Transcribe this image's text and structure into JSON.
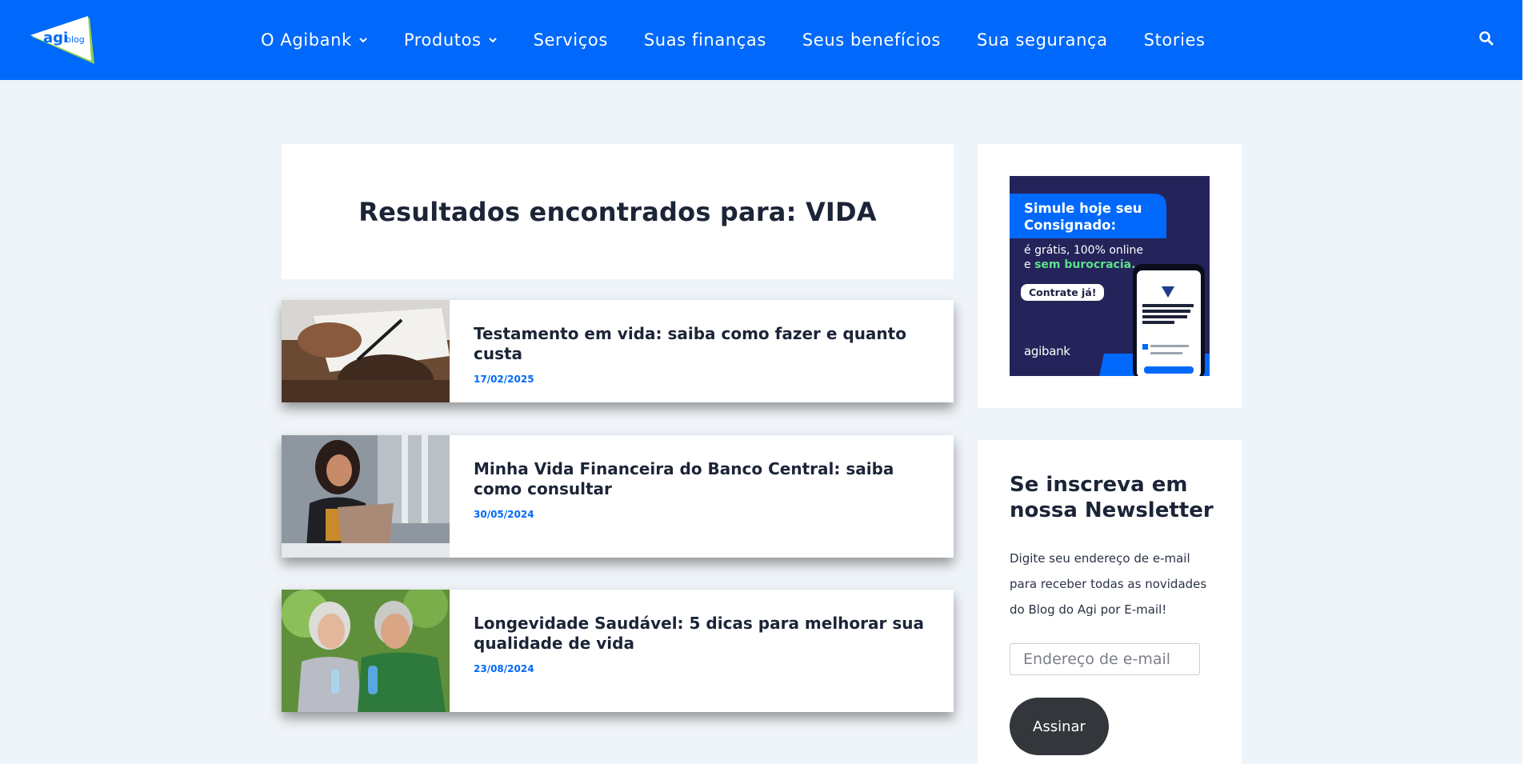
{
  "header": {
    "logo": {
      "brand": "agi",
      "suffix": "blog"
    },
    "nav": [
      {
        "label": "O Agibank",
        "has_dropdown": true
      },
      {
        "label": "Produtos",
        "has_dropdown": true
      },
      {
        "label": "Serviços",
        "has_dropdown": false
      },
      {
        "label": "Suas finanças",
        "has_dropdown": false
      },
      {
        "label": "Seus benefícios",
        "has_dropdown": false
      },
      {
        "label": "Sua segurança",
        "has_dropdown": false
      },
      {
        "label": "Stories",
        "has_dropdown": false
      }
    ],
    "search_icon": "search-icon"
  },
  "main": {
    "results_title": "Resultados encontrados para: VIDA",
    "posts": [
      {
        "title": "Testamento em vida: saiba como fazer e quanto custa",
        "date": "17/02/2025"
      },
      {
        "title": "Minha Vida Financeira do Banco Central: saiba como consultar",
        "date": "30/05/2024"
      },
      {
        "title": "Longevidade Saudável: 5 dicas para melhorar sua qualidade de vida",
        "date": "23/08/2024"
      }
    ]
  },
  "sidebar": {
    "ad": {
      "title": "Simule hoje seu Consignado:",
      "subtitle_plain": "é grátis, 100% online e",
      "subtitle_highlight": "sem burocracia.",
      "cta": "Contrate já!",
      "brand": "agibank"
    },
    "newsletter": {
      "title": "Se inscreva em nossa Newsletter",
      "description": "Digite seu endereço de e-mail para receber todas as novidades do Blog do Agi por E-mail!",
      "email_placeholder": "Endereço de e-mail",
      "submit_label": "Assinar"
    }
  },
  "colors": {
    "brand_blue": "#0069fb",
    "page_bg": "#eff4f8",
    "heading": "#1c2437",
    "button_dark": "#33373b",
    "ad_bg": "#24235a",
    "ad_green": "#5ee08c"
  }
}
